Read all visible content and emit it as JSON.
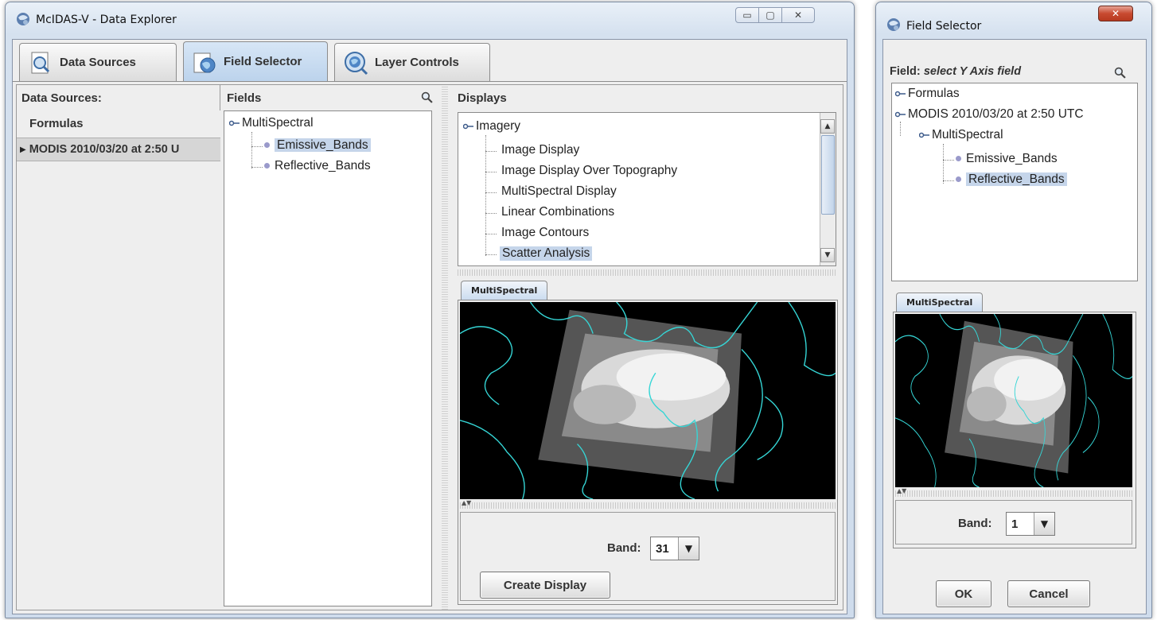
{
  "main_window": {
    "title": "McIDAS-V - Data Explorer",
    "controls": {
      "minimize": "▭",
      "maximize": "▢",
      "close": "✕"
    },
    "tabs": [
      {
        "label": "Data Sources",
        "icon": "magnifier-document-icon"
      },
      {
        "label": "Field Selector",
        "icon": "globe-document-icon"
      },
      {
        "label": "Layer Controls",
        "icon": "magnifier-globe-icon"
      }
    ],
    "data_sources_panel": {
      "heading": "Data Sources:",
      "items": [
        "Formulas",
        "MODIS 2010/03/20 at 2:50 U"
      ]
    },
    "fields_panel": {
      "heading": "Fields",
      "root": "MultiSpectral",
      "children": [
        "Emissive_Bands",
        "Reflective_Bands"
      ]
    },
    "displays_panel": {
      "heading": "Displays",
      "root": "Imagery",
      "items": [
        "Image Display",
        "Image Display Over Topography",
        "MultiSpectral Display",
        "Linear Combinations",
        "Image Contours",
        "Scatter Analysis"
      ]
    },
    "preview": {
      "tab_label": "MultiSpectral",
      "band_label": "Band:",
      "band_value": "31"
    },
    "create_button": "Create Display"
  },
  "field_selector_window": {
    "title": "Field Selector",
    "close": "✕",
    "field_prompt_label": "Field:",
    "field_prompt_value": "select Y Axis field",
    "tree": {
      "formulas": "Formulas",
      "source": "MODIS 2010/03/20 at 2:50 UTC",
      "group": "MultiSpectral",
      "children": [
        "Emissive_Bands",
        "Reflective_Bands"
      ]
    },
    "preview": {
      "tab_label": "MultiSpectral",
      "band_label": "Band:",
      "band_value": "1"
    },
    "ok_button": "OK",
    "cancel_button": "Cancel"
  },
  "colors": {
    "selection": "#c5d5ea",
    "coastline": "#35d6d6",
    "window_frame": "#cfdcec"
  }
}
